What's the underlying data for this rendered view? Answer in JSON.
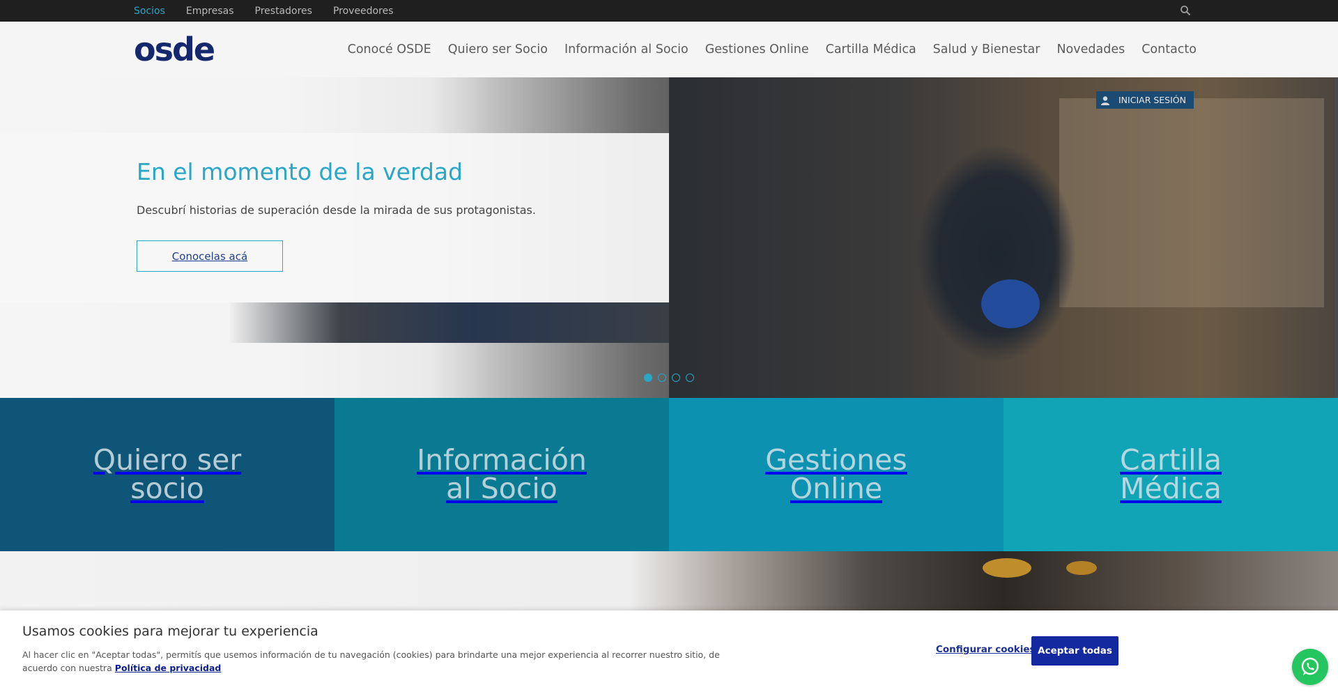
{
  "topbar": {
    "links": [
      {
        "label": "Socios",
        "active": true
      },
      {
        "label": "Empresas",
        "active": false
      },
      {
        "label": "Prestadores",
        "active": false
      },
      {
        "label": "Proveedores",
        "active": false
      }
    ],
    "search_icon": "search-icon"
  },
  "header": {
    "logo": "osde",
    "nav": [
      "Conocé OSDE",
      "Quiero ser Socio",
      "Información al Socio",
      "Gestiones Online",
      "Cartilla Médica",
      "Salud y Bienestar",
      "Novedades",
      "Contacto"
    ]
  },
  "hero": {
    "title": "En el momento de la verdad",
    "subtitle": "Descubrí historias de superación desde la mirada de sus protagonistas.",
    "cta": "Conocelas acá",
    "login": "INICIAR SESIÓN",
    "slides_total": 4,
    "active_slide": 1
  },
  "tiles": [
    {
      "line1": "Quiero ser",
      "line2": "socio"
    },
    {
      "line1": "Información",
      "line2": "al Socio"
    },
    {
      "line1": "Gestiones",
      "line2": "Online"
    },
    {
      "line1": "Cartilla",
      "line2": "Médica"
    }
  ],
  "cookie": {
    "title": "Usamos cookies para mejorar tu experiencia",
    "text": "Al hacer clic en \"Aceptar todas\", permitís que usemos información de tu navegación (cookies) para brindarte una mejor experiencia al recorrer nuestro sitio, de acuerdo con nuestra",
    "privacy_link": "Política de privacidad",
    "configure": "Configurar cookies",
    "accept": "Aceptar todas"
  },
  "colors": {
    "accent": "#2aa6c7",
    "brand": "#15286e",
    "accept_button": "#1428a0",
    "whatsapp": "#25c65f"
  }
}
